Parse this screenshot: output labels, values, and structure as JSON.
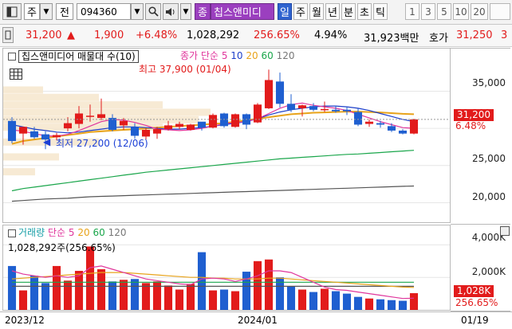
{
  "toolbar": {
    "market_select": "주",
    "mode_label": "전",
    "code": "094360",
    "sector_label": "종",
    "stock_name": "칩스앤미디",
    "periods": [
      "일",
      "주",
      "월",
      "년",
      "분",
      "초",
      "틱"
    ],
    "minutes": [
      "1",
      "3",
      "5",
      "10",
      "20"
    ]
  },
  "quote": {
    "price": "31,200",
    "arrow": "▲",
    "change": "1,900",
    "change_pct": "+6.48%",
    "volume": "1,028,292",
    "volume_ratio": "256.65%",
    "turnover": "4.94%",
    "amount": "31,923백만",
    "ask_label": "호가",
    "ask_price": "31,250",
    "ask_more": "3"
  },
  "price_panel": {
    "title": "칩스앤미디어 매물대 수(10)",
    "ma_label": "종가 단순",
    "ma_periods": [
      "5",
      "10",
      "20",
      "60",
      "120"
    ],
    "high_note": "최고 37,900 (01/04)",
    "low_note": "최저 27,200 (12/06)",
    "y_ticks": [
      "35,000",
      "30,000",
      "25,000",
      "20,000"
    ],
    "current_price_tag": "31,200",
    "current_pct_tag": "6.48%"
  },
  "volume_panel": {
    "label": "거래량",
    "ma_label": "단순",
    "ma_periods": [
      "5",
      "20",
      "60",
      "120"
    ],
    "value_text": "1,028,292주(256.65%)",
    "y_ticks": [
      "4,000K",
      "2,000K"
    ],
    "current_tag": "1,028K",
    "pct_tag": "256.65%"
  },
  "x_axis": {
    "labels": [
      "2023/12",
      "2024/01",
      "01/19"
    ]
  },
  "colors": {
    "up": "#e21b1b",
    "down": "#1f5fd0",
    "ma5": "#e0369c",
    "ma10": "#1d3fc9",
    "ma20": "#e8a31a",
    "ma60": "#1aa64b",
    "ma120": "#555555"
  },
  "chart_data": {
    "type": "candlestick",
    "candles": [
      {
        "o": 31000,
        "h": 31500,
        "l": 28000,
        "c": 28300
      },
      {
        "o": 29300,
        "h": 30200,
        "l": 27800,
        "c": 30200
      },
      {
        "o": 29600,
        "h": 30200,
        "l": 28600,
        "c": 28800
      },
      {
        "o": 29200,
        "h": 29600,
        "l": 27200,
        "c": 28500
      },
      {
        "o": 28800,
        "h": 29400,
        "l": 28400,
        "c": 29100
      },
      {
        "o": 30000,
        "h": 31500,
        "l": 29600,
        "c": 30700
      },
      {
        "o": 30600,
        "h": 33000,
        "l": 30000,
        "c": 32000
      },
      {
        "o": 31600,
        "h": 33200,
        "l": 30900,
        "c": 31700
      },
      {
        "o": 31400,
        "h": 34000,
        "l": 31100,
        "c": 31900
      },
      {
        "o": 31400,
        "h": 31900,
        "l": 29600,
        "c": 29800
      },
      {
        "o": 30400,
        "h": 31400,
        "l": 29800,
        "c": 31000
      },
      {
        "o": 30200,
        "h": 30700,
        "l": 28600,
        "c": 29000
      },
      {
        "o": 28900,
        "h": 30000,
        "l": 28500,
        "c": 29800
      },
      {
        "o": 29300,
        "h": 30200,
        "l": 28600,
        "c": 29900
      },
      {
        "o": 29900,
        "h": 31000,
        "l": 29700,
        "c": 30400
      },
      {
        "o": 30200,
        "h": 30900,
        "l": 29900,
        "c": 30600
      },
      {
        "o": 29800,
        "h": 30600,
        "l": 29700,
        "c": 30500
      },
      {
        "o": 30900,
        "h": 30800,
        "l": 29700,
        "c": 30100
      },
      {
        "o": 30100,
        "h": 32000,
        "l": 30000,
        "c": 31800
      },
      {
        "o": 32000,
        "h": 32100,
        "l": 30100,
        "c": 30300
      },
      {
        "o": 30200,
        "h": 32000,
        "l": 30100,
        "c": 31900
      },
      {
        "o": 31900,
        "h": 32000,
        "l": 29900,
        "c": 30500
      },
      {
        "o": 30800,
        "h": 33400,
        "l": 30700,
        "c": 33200
      },
      {
        "o": 32700,
        "h": 37900,
        "l": 32600,
        "c": 36500
      },
      {
        "o": 36300,
        "h": 37500,
        "l": 32800,
        "c": 33300
      },
      {
        "o": 33300,
        "h": 34600,
        "l": 32200,
        "c": 32500
      },
      {
        "o": 32700,
        "h": 33200,
        "l": 31600,
        "c": 33100
      },
      {
        "o": 33000,
        "h": 33400,
        "l": 32300,
        "c": 32500
      },
      {
        "o": 32500,
        "h": 33600,
        "l": 32200,
        "c": 32600
      },
      {
        "o": 32500,
        "h": 33000,
        "l": 32100,
        "c": 32300
      },
      {
        "o": 32500,
        "h": 32900,
        "l": 31800,
        "c": 32300
      },
      {
        "o": 32200,
        "h": 32700,
        "l": 30300,
        "c": 30500
      },
      {
        "o": 30600,
        "h": 31200,
        "l": 30200,
        "c": 30900
      },
      {
        "o": 30700,
        "h": 31000,
        "l": 30100,
        "c": 30500
      },
      {
        "o": 30300,
        "h": 30700,
        "l": 29500,
        "c": 29700
      },
      {
        "o": 29700,
        "h": 29900,
        "l": 29200,
        "c": 29300
      },
      {
        "o": 29300,
        "h": 31300,
        "l": 29200,
        "c": 31200
      }
    ],
    "volume": [
      2700,
      1200,
      2100,
      1650,
      2700,
      1800,
      2400,
      3900,
      2500,
      1750,
      1850,
      1900,
      1650,
      1750,
      1500,
      1250,
      1600,
      3550,
      1200,
      1250,
      1150,
      2350,
      3000,
      3100,
      2000,
      1450,
      1250,
      1100,
      1300,
      1150,
      1000,
      800,
      700,
      650,
      600,
      560,
      1028
    ],
    "ma5": [
      29800,
      29600,
      29300,
      29000,
      28950,
      29200,
      29700,
      30300,
      30900,
      31200,
      31100,
      30800,
      30400,
      29900,
      29800,
      29700,
      29800,
      30000,
      30300,
      30600,
      30800,
      30900,
      31300,
      32000,
      32700,
      33200,
      33400,
      33100,
      32900,
      32700,
      32400,
      31900,
      31400,
      30900,
      30500,
      30100,
      30000
    ],
    "ma10": [
      30500,
      30200,
      29900,
      29700,
      29500,
      29400,
      29500,
      29700,
      29900,
      30100,
      30200,
      30200,
      30100,
      30000,
      29900,
      29900,
      30000,
      30100,
      30300,
      30500,
      30700,
      30900,
      31300,
      31800,
      32200,
      32500,
      32700,
      32900,
      33000,
      33000,
      32900,
      32700,
      32400,
      32000,
      31600,
      31200,
      30900
    ],
    "ma20": [
      27900,
      28300,
      28500,
      28700,
      28900,
      29100,
      29300,
      29500,
      29600,
      29700,
      29800,
      29900,
      30000,
      30100,
      30200,
      30300,
      30400,
      30500,
      30600,
      30700,
      30900,
      31100,
      31300,
      31500,
      31700,
      31900,
      32000,
      32100,
      32150,
      32200,
      32250,
      32250,
      32200,
      32150,
      32050,
      31950,
      31900
    ],
    "ma60": [
      21600,
      21900,
      22100,
      22300,
      22500,
      22700,
      22900,
      23100,
      23300,
      23500,
      23700,
      23900,
      24100,
      24250,
      24400,
      24550,
      24700,
      24850,
      25000,
      25150,
      25300,
      25450,
      25600,
      25750,
      25900,
      26000,
      26100,
      26200,
      26300,
      26400,
      26500,
      26550,
      26650,
      26750,
      26850,
      26950,
      27050
    ],
    "ma120": [
      20200,
      20300,
      20400,
      20500,
      20550,
      20600,
      20700,
      20800,
      20850,
      20900,
      20950,
      21000,
      21050,
      21100,
      21150,
      21200,
      21250,
      21300,
      21350,
      21400,
      21450,
      21500,
      21550,
      21600,
      21650,
      21700,
      21750,
      21800,
      21850,
      21900,
      21950,
      22000,
      22050,
      22100,
      22150,
      22200,
      22250
    ],
    "vol_ma5": [
      2400,
      2200,
      2100,
      2000,
      2100,
      2000,
      2100,
      2600,
      2700,
      2500,
      2300,
      2100,
      1900,
      1800,
      1700,
      1600,
      1550,
      1900,
      1950,
      1900,
      1750,
      1900,
      2100,
      2400,
      2400,
      2300,
      2000,
      1700,
      1400,
      1250,
      1200,
      1100,
      1000,
      900,
      800,
      700,
      720
    ],
    "vol_ma20": [
      1900,
      1950,
      2000,
      2050,
      2100,
      2150,
      2200,
      2250,
      2300,
      2300,
      2300,
      2250,
      2200,
      2150,
      2100,
      2050,
      2000,
      2000,
      1950,
      1950,
      1900,
      1900,
      1900,
      1950,
      1950,
      1900,
      1850,
      1800,
      1750,
      1700,
      1650,
      1600,
      1550,
      1500,
      1450,
      1400,
      1380
    ],
    "vol_ma60": [
      1700,
      1700,
      1700,
      1700,
      1700,
      1700,
      1700,
      1700,
      1700,
      1700,
      1700,
      1700,
      1700,
      1700,
      1700,
      1700,
      1700,
      1700,
      1700,
      1700,
      1700,
      1700,
      1700,
      1700,
      1700,
      1700,
      1700,
      1700,
      1700,
      1700,
      1700,
      1700,
      1700,
      1700,
      1700,
      1700,
      1700
    ],
    "vol_ma120": [
      1450,
      1450,
      1450,
      1450,
      1450,
      1450,
      1450,
      1450,
      1450,
      1450,
      1450,
      1450,
      1450,
      1450,
      1450,
      1450,
      1450,
      1450,
      1450,
      1450,
      1450,
      1450,
      1450,
      1450,
      1450,
      1450,
      1450,
      1450,
      1450,
      1450,
      1450,
      1450,
      1450,
      1450,
      1450,
      1450,
      1450
    ],
    "price_ylim": [
      17800,
      38800
    ],
    "volume_ylim": [
      0,
      5000
    ]
  }
}
